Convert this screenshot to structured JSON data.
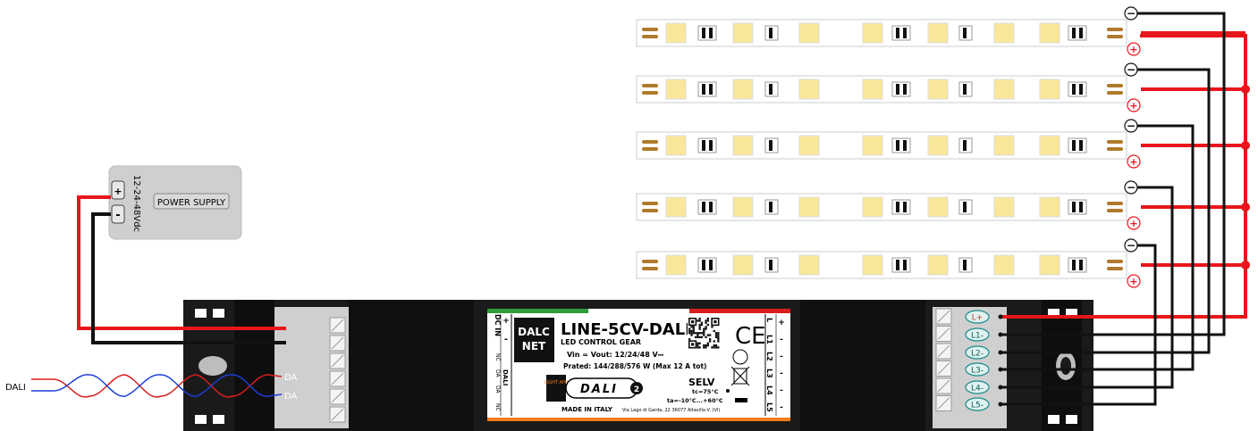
{
  "colors": {
    "wire_positive": "#e8161b",
    "wire_negative": "#111111",
    "dali_red": "#d81e1e",
    "dali_blue": "#1b3fd6",
    "led_chip": "#f9e79a",
    "strip_bg": "#ffffff",
    "case": "#1a1a1a",
    "terminal_teal": "#1a8a8a",
    "psu_body": "#cfcfcf"
  },
  "dali_input": {
    "label": "DALI"
  },
  "power_supply": {
    "title": "POWER SUPPLY",
    "voltage": "12-24-48Vdc",
    "plus": "+",
    "minus": "-"
  },
  "input_terminal": {
    "da1": "DA",
    "da2": "DA"
  },
  "controller": {
    "model": "LINE-5CV-DALI",
    "subtitle": "LED CONTROL GEAR",
    "vin": "Vin = Vout: 12/24/48 V⎓",
    "prated": "Prated: 144/288/576 W (Max 12 A tot)",
    "brand_line1": "DALC",
    "brand_line2": "NET",
    "dali_logo": "DALI",
    "dali_version": "2",
    "selv": "SELV",
    "tc": "tc=75°C",
    "ta": "ta=-10°C...+60°C",
    "made_in": "MADE IN ITALY",
    "address": "Via Lago di Garda, 22 36077 Altavilla V. (VI)",
    "ce": "CE",
    "app_label": "LIGHT APP",
    "left_col": [
      "DC IN",
      "+",
      "-",
      "NC",
      "DALI",
      "DA",
      "DA",
      "NC"
    ],
    "right_col": [
      "L",
      "+",
      "L1",
      "-",
      "L2",
      "-",
      "L3",
      "-",
      "L4",
      "-",
      "L5",
      "-"
    ]
  },
  "output_terminals": [
    "L+",
    "L1-",
    "L2-",
    "L3-",
    "L4-",
    "L5-"
  ],
  "strip_terminals": {
    "minus": "−",
    "plus": "+"
  }
}
